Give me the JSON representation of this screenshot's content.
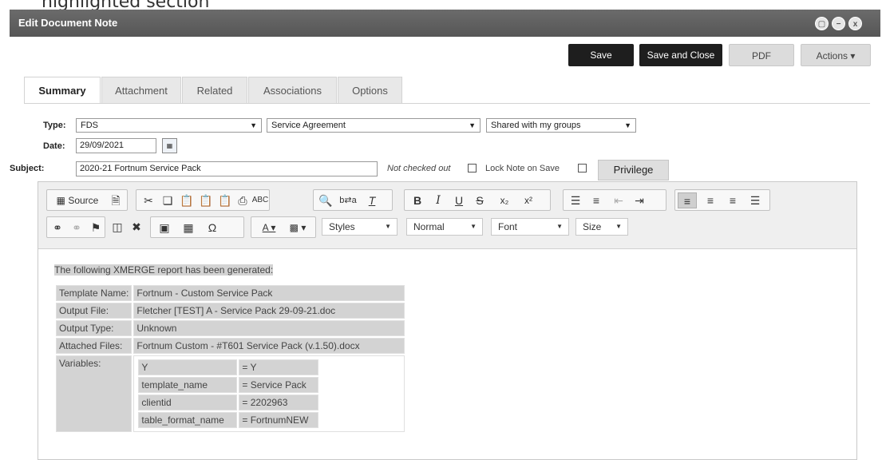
{
  "caption": "highlighted section",
  "window": {
    "title": "Edit Document Note",
    "controls": [
      "restore-icon",
      "minimize-icon",
      "close-icon"
    ]
  },
  "actions": {
    "save": "Save",
    "save_close": "Save and Close",
    "pdf": "PDF",
    "actions": "Actions ▾"
  },
  "tabs": [
    {
      "label": "Summary",
      "active": true
    },
    {
      "label": "Attachment"
    },
    {
      "label": "Related"
    },
    {
      "label": "Associations"
    },
    {
      "label": "Options"
    }
  ],
  "form": {
    "type_label": "Type:",
    "type_value": "FDS",
    "category_value": "Service Agreement",
    "sharing_value": "Shared with my groups",
    "date_label": "Date:",
    "date_value": "29/09/2021",
    "subject_label": "Subject:",
    "subject_value": "2020-21 Fortnum Service Pack",
    "checkout_status": "Not checked out",
    "lock_label": "Lock Note on Save",
    "privilege": "Privilege"
  },
  "toolbar": {
    "source": "Source",
    "styles": "Styles",
    "format": "Normal",
    "font": "Font",
    "size": "Size"
  },
  "report": {
    "title": "The following XMERGE report has been generated:",
    "rows": [
      {
        "label": "Template Name:",
        "value": "Fortnum - Custom Service Pack"
      },
      {
        "label": "Output File:",
        "value": "Fletcher [TEST] A - Service Pack 29-09-21.doc"
      },
      {
        "label": "Output Type:",
        "value": "Unknown"
      },
      {
        "label": "Attached Files:",
        "value": "Fortnum Custom - #T601 Service Pack (v.1.50).docx"
      }
    ],
    "variables_label": "Variables:",
    "variables": [
      {
        "name": "Y",
        "value": "= Y"
      },
      {
        "name": "template_name",
        "value": "= Service Pack"
      },
      {
        "name": "clientid",
        "value": "= 2202963"
      },
      {
        "name": "table_format_name",
        "value": "= FortnumNEW"
      }
    ]
  }
}
